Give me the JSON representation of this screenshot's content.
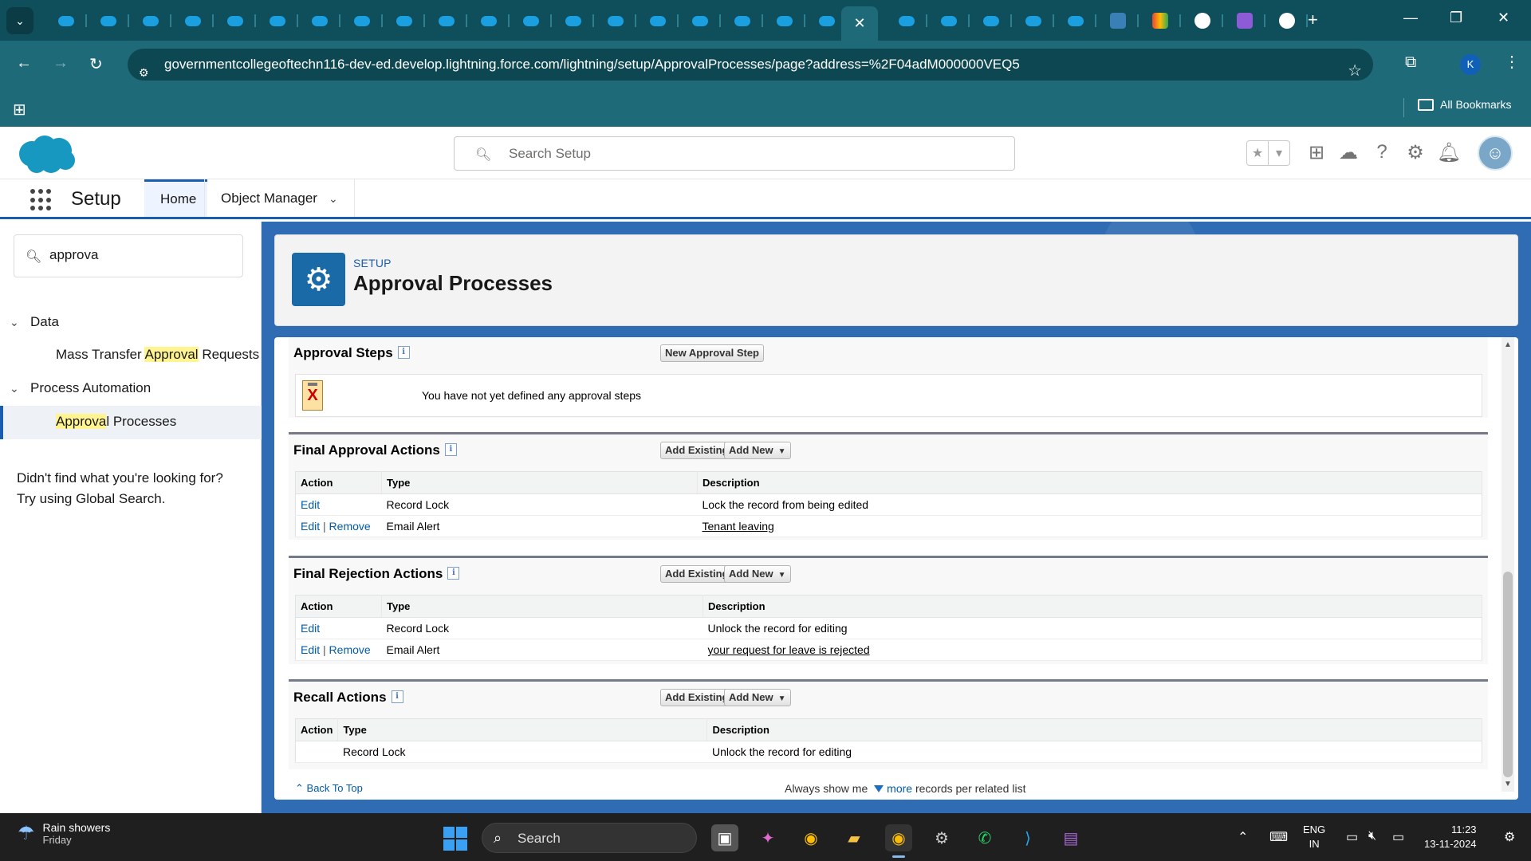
{
  "browser": {
    "url": "governmentcollegeoftechn116-dev-ed.develop.lightning.force.com/lightning/setup/ApprovalProcesses/page?address=%2F04adM000000VEQ5",
    "profile_initial": "K",
    "all_bookmarks_label": "All Bookmarks",
    "new_tab_label": "+"
  },
  "header": {
    "search_placeholder": "Search Setup"
  },
  "nav": {
    "app_name": "Setup",
    "tabs": [
      {
        "label": "Home"
      },
      {
        "label": "Object Manager"
      }
    ]
  },
  "sidebar": {
    "quickfind_value": "approva",
    "sections": [
      {
        "label": "Data",
        "items": [
          {
            "pre": "Mass Transfer ",
            "hl": "Approval",
            "post": " Requests"
          }
        ]
      },
      {
        "label": "Process Automation",
        "items": [
          {
            "pre": "",
            "hl": "Approva",
            "post": "l Processes"
          }
        ]
      }
    ],
    "not_found_line1": "Didn't find what you're looking for?",
    "not_found_line2": "Try using Global Search."
  },
  "page": {
    "breadcrumb": "SETUP",
    "title": "Approval Processes"
  },
  "approval_steps": {
    "title": "Approval Steps",
    "button": "New Approval Step",
    "empty_text": "You have not yet defined any approval steps"
  },
  "final_approval": {
    "title": "Final Approval Actions",
    "add_existing": "Add Existing",
    "add_new": "Add New",
    "columns": [
      "Action",
      "Type",
      "Description"
    ],
    "rows": [
      {
        "edit": "Edit",
        "remove": "",
        "type": "Record Lock",
        "description": "Lock the record from being edited",
        "desc_link": false
      },
      {
        "edit": "Edit",
        "remove": "Remove",
        "type": "Email Alert",
        "description": "Tenant leaving",
        "desc_link": true
      }
    ]
  },
  "final_rejection": {
    "title": "Final Rejection Actions",
    "add_existing": "Add Existing",
    "add_new": "Add New",
    "columns": [
      "Action",
      "Type",
      "Description"
    ],
    "rows": [
      {
        "edit": "Edit",
        "remove": "",
        "type": "Record Lock",
        "description": "Unlock the record for editing",
        "desc_link": false
      },
      {
        "edit": "Edit",
        "remove": "Remove",
        "type": "Email Alert",
        "description": "your request for leave is rejected",
        "desc_link": true
      }
    ]
  },
  "recall": {
    "title": "Recall Actions",
    "add_existing": "Add Existing",
    "add_new": "Add New",
    "columns": [
      "Action",
      "Type",
      "Description"
    ],
    "rows": [
      {
        "type": "Record Lock",
        "description": "Unlock the record for editing"
      }
    ]
  },
  "footer": {
    "back_to_top": "Back To Top",
    "show_pre": "Always show me",
    "show_more": "more",
    "show_post": "records per related list"
  },
  "taskbar": {
    "weather_title": "Rain showers",
    "weather_day": "Friday",
    "search_label": "Search",
    "lang_line1": "ENG",
    "lang_line2": "IN",
    "time": "11:23",
    "date": "13-11-2024"
  },
  "colors": {
    "brand_blue": "#1b5eb0",
    "link_blue": "#015ba7",
    "browser_teal": "#1e6a79"
  }
}
